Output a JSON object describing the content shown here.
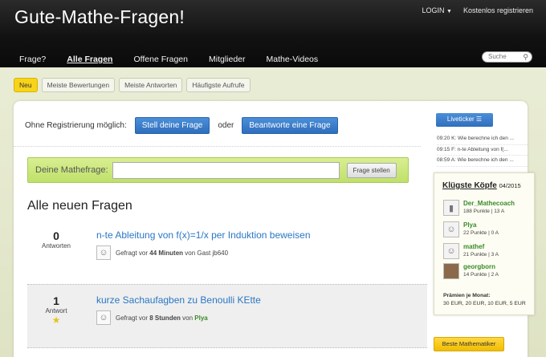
{
  "header": {
    "site_title": "Gute-Mathe-Fragen!",
    "login": "LOGIN",
    "register": "Kostenlos registrieren",
    "nav": [
      "Frage?",
      "Alle Fragen",
      "Offene Fragen",
      "Mitglieder",
      "Mathe-Videos"
    ],
    "search_placeholder": "Suche"
  },
  "filters": [
    "Neu",
    "Meiste Bewertungen",
    "Meiste Antworten",
    "Häufigste Aufrufe"
  ],
  "cta": {
    "label": "Ohne Registrierung möglich:",
    "ask_button": "Stell deine Frage",
    "or": "oder",
    "answer_button": "Beantworte eine Frage"
  },
  "ask_box": {
    "label": "Deine Mathefrage:",
    "button": "Frage stellen"
  },
  "section_title": "Alle neuen Fragen",
  "questions": [
    {
      "count": "0",
      "count_label": "Antworten",
      "title": "n-te Ableitung von f(x)=1/x per Induktion beweisen",
      "meta_prefix": "Gefragt vor",
      "time": "44 Minuten",
      "by": "von Gast jb640"
    },
    {
      "count": "1",
      "count_label": "Antwort",
      "title": "kurze Sachaufagben zu Benoulli KEtte",
      "meta_prefix": "Gefragt vor",
      "time": "8 Stunden",
      "by": "von",
      "user": "Plya"
    }
  ],
  "ticker": {
    "button": "Liveticker ☰",
    "items": [
      "09:20 K: Wie berechne ich den ...",
      "09:15 F: n-te Ableitung von f(...",
      "08:59 A: Wie berechne ich den ..."
    ]
  },
  "leaders": {
    "title": "Klügste Köpfe",
    "month": "04/2015",
    "items": [
      {
        "name": "Der_Mathecoach",
        "points": "188 Punkte | 13 A"
      },
      {
        "name": "Plya",
        "points": "22 Punkte | 0 A"
      },
      {
        "name": "mathef",
        "points": "21 Punkte | 3 A"
      },
      {
        "name": "georgborn",
        "points": "14 Punkte | 2 A"
      }
    ],
    "prize_title": "Prämien je Monat:",
    "prize_values": "30 EUR, 20 EUR, 10 EUR, 5 EUR"
  },
  "best_button": "Beste Mathematiker"
}
